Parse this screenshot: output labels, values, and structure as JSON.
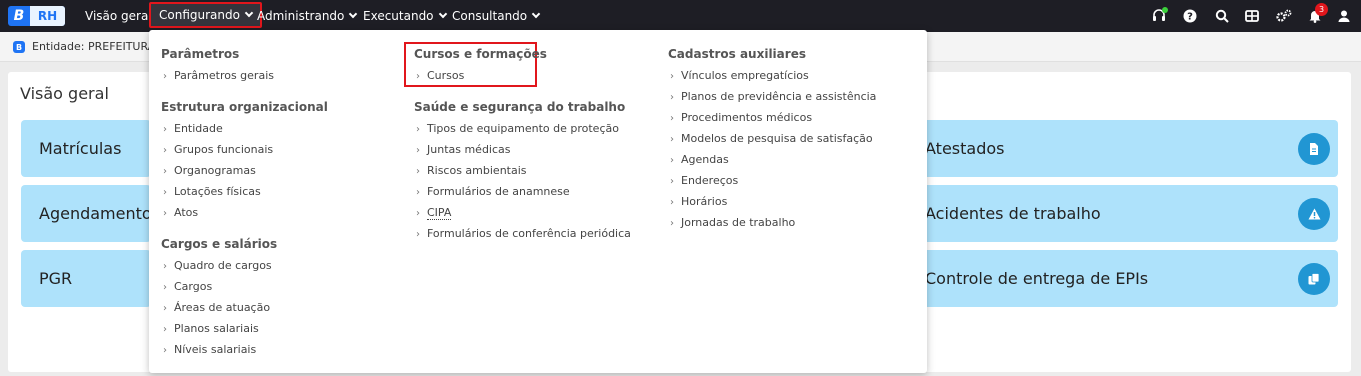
{
  "app": {
    "logo_letter": "B",
    "logo_name": "RH"
  },
  "nav": [
    {
      "label": "Visão geral",
      "active": false
    },
    {
      "label": "Configurando",
      "active": true
    },
    {
      "label": "Administrando",
      "active": false
    },
    {
      "label": "Executando",
      "active": false
    },
    {
      "label": "Consultando",
      "active": false
    }
  ],
  "toolbar_icons": [
    "headset-icon",
    "help-icon",
    "search-icon",
    "grid-icon",
    "settings-icon",
    "bell-icon",
    "user-icon"
  ],
  "notifications": {
    "count": "3"
  },
  "entity": {
    "badge": "B",
    "text": "Entidade: PREFEITURA D"
  },
  "overview": {
    "title": "Visão geral",
    "cards_left": [
      "Matrículas",
      "Agendamento",
      "PGR"
    ],
    "cards_right": [
      "Atestados",
      "Acidentes de trabalho",
      "Controle de entrega de EPIs"
    ],
    "card_icons": [
      "document-icon",
      "warning-icon",
      "copy-icon"
    ]
  },
  "menu": {
    "col1": {
      "sections": [
        {
          "title": "Parâmetros",
          "items": [
            "Parâmetros gerais"
          ]
        },
        {
          "title": "Estrutura organizacional",
          "items": [
            "Entidade",
            "Grupos funcionais",
            "Organogramas",
            "Lotações físicas",
            "Atos"
          ]
        },
        {
          "title": "Cargos e salários",
          "items": [
            "Quadro de cargos",
            "Cargos",
            "Áreas de atuação",
            "Planos salariais",
            "Níveis salariais"
          ]
        }
      ]
    },
    "col2": {
      "sections": [
        {
          "title": "Cursos e formações",
          "items": [
            "Cursos"
          ]
        },
        {
          "title": "Saúde e segurança do trabalho",
          "items": [
            "Tipos de equipamento de proteção",
            "Juntas médicas",
            "Riscos ambientais",
            "Formulários de anamnese",
            "CIPA",
            "Formulários de conferência periódica"
          ]
        }
      ]
    },
    "col3": {
      "sections": [
        {
          "title": "Cadastros auxiliares",
          "items": [
            "Vínculos empregatícios",
            "Planos de previdência e assistência",
            "Procedimentos médicos",
            "Modelos de pesquisa de satisfação",
            "Agendas",
            "Endereços",
            "Horários",
            "Jornadas de trabalho"
          ]
        }
      ]
    }
  },
  "colors": {
    "topbar": "#1e1e25",
    "accent": "#1f74f4",
    "highlight": "#e1161c",
    "card": "#aee2fb",
    "card_icon": "#2196d3"
  }
}
